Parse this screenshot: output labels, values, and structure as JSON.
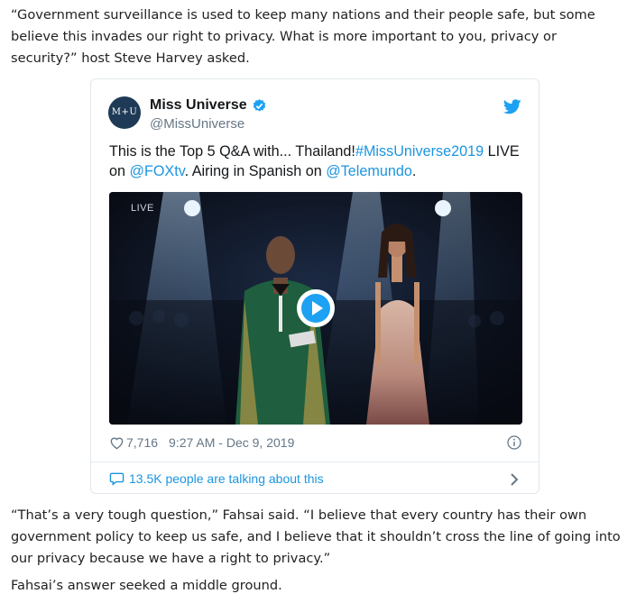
{
  "article": {
    "paragraph1": "“Government surveillance is used to keep many nations and their people safe, but some believe this invades our right to privacy. What is more important to you, privacy or security?” host Steve Harvey asked.",
    "paragraph2": "“That’s a very tough question,” Fahsai said. “I believe that every country has their own government policy to keep us safe, and I believe that it shouldn’t cross the line of going into our privacy because we have a right to privacy.”",
    "paragraph3": "Fahsai’s answer seeked a middle ground."
  },
  "tweet": {
    "avatar_text": "M+U",
    "name": "Miss Universe",
    "handle": "@MissUniverse",
    "text_part1": "This is the Top 5 Q&A with... Thailand!",
    "hashtag": "#MissUniverse2019",
    "text_part2": " LIVE on ",
    "mention1": "@FOXtv",
    "text_part3": ". Airing in Spanish on ",
    "mention2": "@Telemundo",
    "text_part4": ".",
    "media_badge": "LIVE",
    "likes": "7,716",
    "timestamp": "9:27 AM - Dec 9, 2019",
    "talking": "13.5K people are talking about this"
  },
  "colors": {
    "link": "#1b95e0",
    "play_button": "#1da1f2",
    "verified": "#1da1f2"
  },
  "icons": [
    "verified-badge-icon",
    "twitter-bird-icon",
    "play-icon",
    "heart-icon",
    "info-icon",
    "comment-bubble-icon",
    "chevron-right-icon"
  ]
}
